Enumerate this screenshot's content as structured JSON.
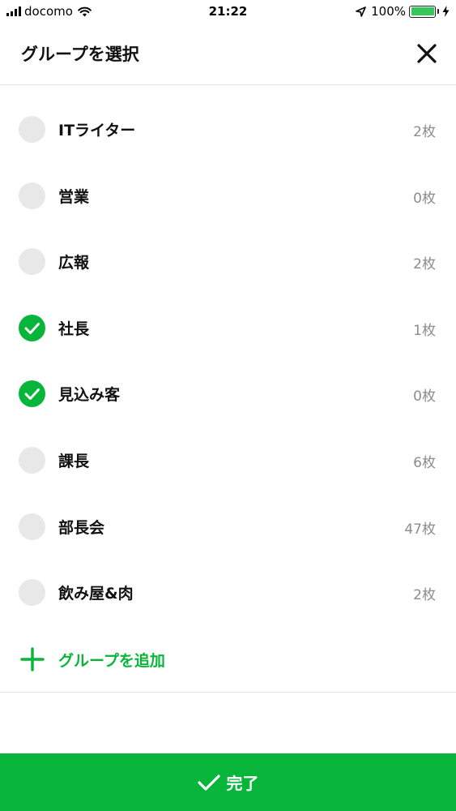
{
  "status_bar": {
    "carrier": "docomo",
    "time": "21:22",
    "battery_percent": "100%",
    "battery_level": 1.0,
    "icons": [
      "signal-icon",
      "wifi-icon",
      "location-icon",
      "battery-icon",
      "charging-icon"
    ]
  },
  "header": {
    "title": "グループを選択",
    "close_icon": "close-icon"
  },
  "groups": [
    {
      "name": "ITライター",
      "count": "2枚",
      "checked": false
    },
    {
      "name": "営業",
      "count": "0枚",
      "checked": false
    },
    {
      "name": "広報",
      "count": "2枚",
      "checked": false
    },
    {
      "name": "社長",
      "count": "1枚",
      "checked": true
    },
    {
      "name": "見込み客",
      "count": "0枚",
      "checked": true
    },
    {
      "name": "課長",
      "count": "6枚",
      "checked": false
    },
    {
      "name": "部長会",
      "count": "47枚",
      "checked": false
    },
    {
      "name": "飲み屋&肉",
      "count": "2枚",
      "checked": false
    }
  ],
  "add_group": {
    "label": "グループを追加",
    "icon": "plus-icon"
  },
  "done_button": {
    "label": "完了",
    "icon": "check-icon"
  },
  "colors": {
    "accent": "#07b53b",
    "unchecked": "#e8e8e8",
    "count_text": "#8c8c8c",
    "divider": "#e3e3e3"
  }
}
